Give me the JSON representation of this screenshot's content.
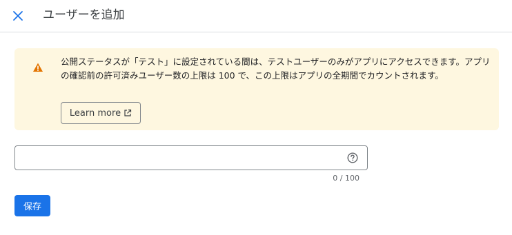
{
  "header": {
    "close_icon": "close-icon",
    "title": "ユーザーを追加"
  },
  "banner": {
    "icon": "warning-icon",
    "icon_color": "#e37400",
    "background": "#fef7e0",
    "message": "公開ステータスが「テスト」に設定されている間は、テストユーザーのみがアプリにアクセスできます。アプリの確認前の許可済みユーザー数の上限は 100 で、この上限はアプリの全期間でカウントされます。",
    "learn_more_label": "Learn more",
    "learn_more_icon": "external-link-icon"
  },
  "user_field": {
    "value": "",
    "help_icon": "help-icon",
    "counter": "0 / 100"
  },
  "actions": {
    "save_label": "保存",
    "save_color": "#1a73e8"
  }
}
